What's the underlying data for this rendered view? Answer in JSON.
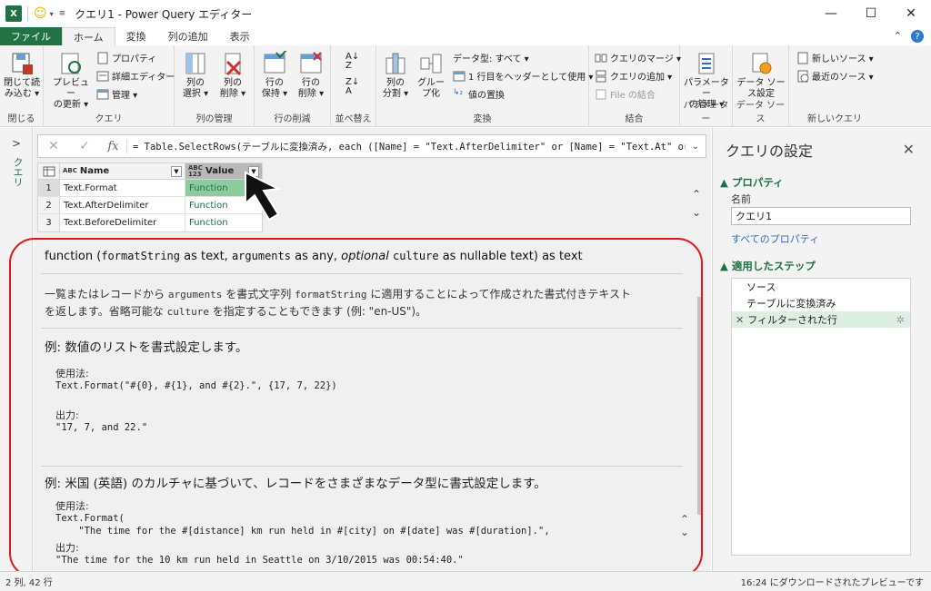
{
  "window": {
    "title": "クエリ1 - Power Query エディター",
    "app_badge": "X",
    "controls": {
      "minimize": "—",
      "maximize": "☐",
      "close": "✕"
    }
  },
  "tabs": [
    {
      "label": "ファイル"
    },
    {
      "label": "ホーム"
    },
    {
      "label": "変換"
    },
    {
      "label": "列の追加"
    },
    {
      "label": "表示"
    }
  ],
  "ribbon": {
    "close_load": {
      "label1": "閉じて読",
      "label2": "み込む ▾",
      "group": "閉じる"
    },
    "preview": {
      "label1": "プレビュー",
      "label2": "の更新 ▾"
    },
    "properties": "プロパティ",
    "advanced_editor": "詳細エディター",
    "manage": "管理 ▾",
    "query_group": "クエリ",
    "select_cols": {
      "label1": "列の",
      "label2": "選択 ▾"
    },
    "remove_cols": {
      "label1": "列の",
      "label2": "削除 ▾"
    },
    "col_mgmt_group": "列の管理",
    "keep_rows": {
      "label1": "行の",
      "label2": "保持 ▾"
    },
    "remove_rows": {
      "label1": "行の",
      "label2": "削除 ▾"
    },
    "row_reduce_group": "行の削減",
    "sort_group": "並べ替え",
    "split_col": {
      "label1": "列の",
      "label2": "分割 ▾"
    },
    "group_by": {
      "label1": "グルー",
      "label2": "プ化"
    },
    "data_type": "データ型: すべて ▾",
    "first_row_header": "1 行目をヘッダーとして使用 ▾",
    "replace_values": "値の置換",
    "transform_group": "変換",
    "merge_queries": "クエリのマージ ▾",
    "append_queries": "クエリの追加 ▾",
    "combine_files": "File の結合",
    "combine_group": "結合",
    "params": {
      "label1": "パラメーター",
      "label2": "の管理 ▾",
      "group": "パラメーター"
    },
    "ds_settings": {
      "label1": "データ ソー",
      "label2": "ス設定",
      "group": "データ ソース"
    },
    "new_source": "新しいソース ▾",
    "recent_sources": "最近のソース ▾",
    "new_query_group": "新しいクエリ"
  },
  "left_pane": {
    "label": "クエリ",
    "chevron": ">"
  },
  "formula_bar": {
    "cancel": "✕",
    "confirm": "✓",
    "fx": "fx",
    "formula": "= Table.SelectRows(テーブルに変換済み, each ([Name] = \"Text.AfterDelimiter\" or [Name] = \"Text.At\" or",
    "expand": "⌄"
  },
  "grid": {
    "col_name": "Name",
    "col_value": "Value",
    "type_badge_name": "ABC",
    "type_badge_value": "ABC 123",
    "rows": [
      {
        "num": "1",
        "name": "Text.Format",
        "value": "Function"
      },
      {
        "num": "2",
        "name": "Text.AfterDelimiter",
        "value": "Function"
      },
      {
        "num": "3",
        "name": "Text.BeforeDelimiter",
        "value": "Function"
      }
    ]
  },
  "doc": {
    "sig_prefix": "function (",
    "sig_p1": "formatString",
    "sig_t1": " as text, ",
    "sig_p2": "arguments",
    "sig_t2": " as any, ",
    "sig_opt": "optional",
    "sig_p3": "culture",
    "sig_t3": " as nullable text) as text",
    "desc_a": "一覧またはレコードから ",
    "desc_b": "arguments",
    "desc_c": " を書式文字列 ",
    "desc_d": "formatString",
    "desc_e": " に適用することによって作成された書式付きテキスト",
    "desc_f": "を返します。省略可能な ",
    "desc_g": "culture",
    "desc_h": " を指定することもできます (例: \"en-US\")。",
    "ex1_title": "例: 数値のリストを書式設定します。",
    "usage_label": "使用法:",
    "ex1_code": "Text.Format(\"#{0}, #{1}, and #{2}.\", {17, 7, 22})",
    "output_label": "出力:",
    "ex1_output": "\"17, 7, and 22.\"",
    "ex2_title": "例: 米国 (英語) のカルチャに基づいて、レコードをさまざまなデータ型に書式設定します。",
    "ex2_code1": "Text.Format(",
    "ex2_code2": "    \"The time for the #[distance] km run held in #[city] on #[date] was #[duration].\",",
    "ex2_output": "\"The time for the 10 km run held in Seattle on 3/10/2015 was 00:54:40.\""
  },
  "right_pane": {
    "title": "クエリの設定",
    "close": "✕",
    "properties": "▲ プロパティ",
    "name_label": "名前",
    "name_value": "クエリ1",
    "all_props": "すべてのプロパティ",
    "applied_steps": "▲ 適用したステップ",
    "steps": [
      {
        "label": "ソース"
      },
      {
        "label": "テーブルに変換済み"
      },
      {
        "label": "フィルターされた行"
      }
    ]
  },
  "status": {
    "left": "2 列, 42 行",
    "right": "16:24 にダウンロードされたプレビューです"
  },
  "colors": {
    "accent": "#217346",
    "annotation": "#e0161b",
    "link": "#2b6cc4"
  }
}
